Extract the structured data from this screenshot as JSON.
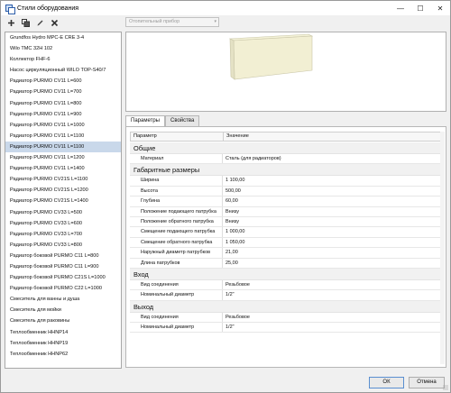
{
  "window": {
    "title": "Стили оборудования",
    "minimize": "—",
    "maximize": "☐",
    "close": "✕"
  },
  "toolbar": {
    "add": "add",
    "copy": "copy",
    "edit": "edit",
    "delete": "delete"
  },
  "category_select": {
    "value": "Отопительный прибор"
  },
  "tree": {
    "selected_index": 11,
    "items": [
      "Grundfos Hydro MPC-E CRE 3-4",
      "Wilo TMC 32H 102",
      "Коллектор FHF-6",
      "Насос циркуляционный WILO TOP-S40/7",
      "Радиатор PURMO CV11 L=600",
      "Радиатор PURMO CV11 L=700",
      "Радиатор PURMO CV11 L=800",
      "Радиатор PURMO CV11 L=900",
      "Радиатор PURMO CV11 L=1000",
      "Радиатор PURMO CV11 L=1100",
      "Радиатор PURMO CV11 L=1100",
      "Радиатор PURMO CV11 L=1200",
      "Радиатор PURMO CV11 L=1400",
      "Радиатор PURMO CV21S L=1100",
      "Радиатор PURMO CV21S L=1200",
      "Радиатор PURMO CV21S L=1400",
      "Радиатор PURMO CV33 L=500",
      "Радиатор PURMO CV33 L=600",
      "Радиатор PURMO CV33 L=700",
      "Радиатор PURMO CV33 L=800",
      "Радиатор боковой PURMO C11 L=800",
      "Радиатор боковой PURMO C11 L=900",
      "Радиатор боковой PURMO C21S L=1000",
      "Радиатор боковой PURMO C22 L=1000",
      "Смеситель для ванны и душа",
      "Смеситель для мойки",
      "Смеситель для раковины",
      "Теплообменник HHNP14",
      "Теплообменник HHNP19",
      "Теплообменник HHNP62"
    ]
  },
  "tabs": [
    "Параметры",
    "Свойства"
  ],
  "grid": {
    "headers": [
      "Параметр",
      "Значение"
    ],
    "groups": [
      {
        "title": "Общие",
        "rows": [
          {
            "name": "Материал",
            "value": "Сталь (для радиаторов)"
          }
        ]
      },
      {
        "title": "Габаритные размеры",
        "rows": [
          {
            "name": "Ширина",
            "value": "1 100,00"
          },
          {
            "name": "Высота",
            "value": "500,00"
          },
          {
            "name": "Глубина",
            "value": "60,00"
          },
          {
            "name": "Положение подающего патрубка",
            "value": "Внизу"
          },
          {
            "name": "Положение обратного патрубка",
            "value": "Внизу"
          },
          {
            "name": "Смещение подающего патрубка",
            "value": "1 000,00"
          },
          {
            "name": "Смещение обратного патрубка",
            "value": "1 050,00"
          },
          {
            "name": "Наружный диаметр патрубков",
            "value": "21,00"
          },
          {
            "name": "Длина патрубков",
            "value": "25,00"
          }
        ]
      },
      {
        "title": "Вход",
        "rows": [
          {
            "name": "Вид соединения",
            "value": "Резьбовое"
          },
          {
            "name": "Номинальный диаметр",
            "value": "1/2\""
          }
        ]
      },
      {
        "title": "Выход",
        "rows": [
          {
            "name": "Вид соединения",
            "value": "Резьбовое"
          },
          {
            "name": "Номинальный диаметр",
            "value": "1/2\""
          }
        ]
      }
    ]
  },
  "buttons": {
    "ok": "ОК",
    "cancel": "Отмена"
  }
}
